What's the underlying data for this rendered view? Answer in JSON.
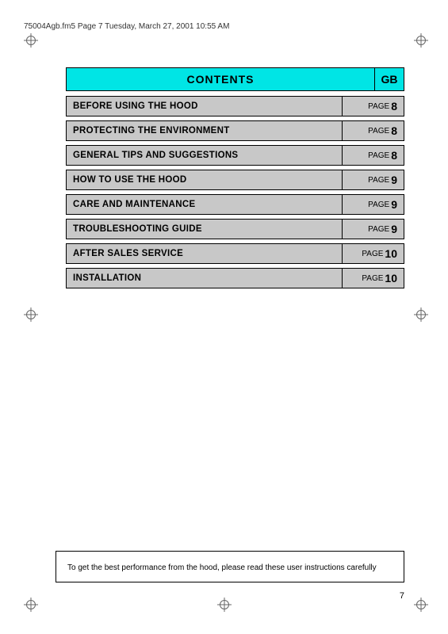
{
  "header": {
    "text": "75004Agb.fm5  Page 7  Tuesday, March 27, 2001  10:55 AM"
  },
  "contents": {
    "title": "CONTENTS",
    "gb_label": "GB"
  },
  "toc_items": [
    {
      "label": "BEFORE USING THE HOOD",
      "page_text": "PAGE",
      "page_num": "8"
    },
    {
      "label": "PROTECTING THE ENVIRONMENT",
      "page_text": "PAGE",
      "page_num": "8"
    },
    {
      "label": "GENERAL TIPS AND SUGGESTIONS",
      "page_text": "PAGE",
      "page_num": "8"
    },
    {
      "label": "HOW TO USE THE HOOD",
      "page_text": "PAGE",
      "page_num": "9"
    },
    {
      "label": "CARE AND MAINTENANCE",
      "page_text": "PAGE",
      "page_num": "9"
    },
    {
      "label": "TROUBLESHOOTING GUIDE",
      "page_text": "PAGE",
      "page_num": "9"
    },
    {
      "label": "AFTER SALES SERVICE",
      "page_text": "PAGE",
      "page_num": "10"
    },
    {
      "label": "INSTALLATION",
      "page_text": "PAGE",
      "page_num": "10"
    }
  ],
  "note": {
    "text": "To get the best performance from the hood, please read these user instructions carefully"
  },
  "page_number": "7",
  "crosshairs": {
    "tl": "top-left",
    "tr": "top-right",
    "ml": "mid-left",
    "mr": "mid-right",
    "bl": "bottom-left",
    "bc": "bottom-center",
    "br": "bottom-right"
  }
}
